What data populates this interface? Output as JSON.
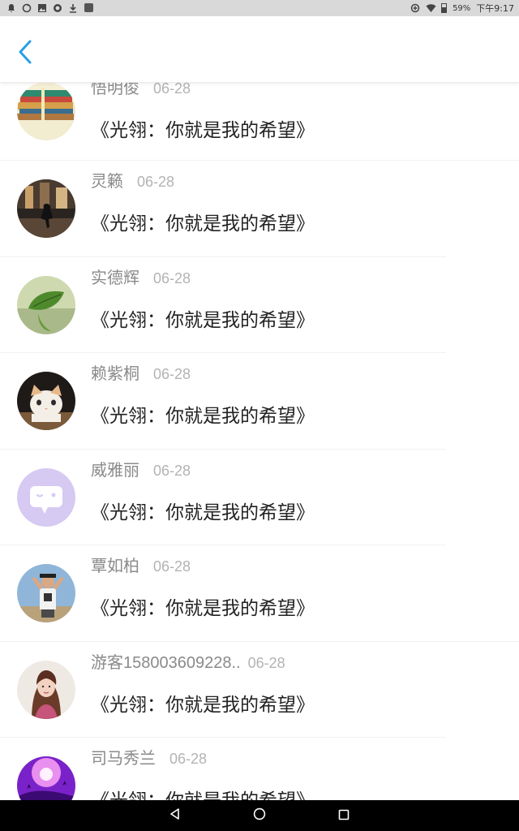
{
  "status_bar": {
    "battery": "59%",
    "time": "下午9:17",
    "left_icons": [
      "notification-icon",
      "sync-icon",
      "image-icon",
      "search-app-icon",
      "download-icon",
      "app-square-icon"
    ],
    "right_icons": [
      "data-saver-icon",
      "wifi-icon",
      "battery-icon"
    ]
  },
  "header": {
    "back_icon": "chevron-left-icon",
    "accent_color": "#2a9ee6"
  },
  "list": {
    "items": [
      {
        "name": "悟明俊",
        "date": "06-28",
        "title": "《光翎：你就是我的希望》",
        "avatar": "notebooks-photo"
      },
      {
        "name": "灵籁",
        "date": "06-28",
        "title": "《光翎：你就是我的希望》",
        "avatar": "night-city-figure-photo"
      },
      {
        "name": "实德辉",
        "date": "06-28",
        "title": "《光翎：你就是我的希望》",
        "avatar": "green-leaf-photo"
      },
      {
        "name": "赖紫桐",
        "date": "06-28",
        "title": "《光翎：你就是我的希望》",
        "avatar": "kitten-photo"
      },
      {
        "name": "威雅丽",
        "date": "06-28",
        "title": "《光翎：你就是我的希望》",
        "avatar": "chat-bubble-default-avatar"
      },
      {
        "name": "覃如柏",
        "date": "06-28",
        "title": "《光翎：你就是我的希望》",
        "avatar": "boy-sky-photo"
      },
      {
        "name": "游客158003609228..",
        "date": "06-28",
        "title": "《光翎：你就是我的希望》",
        "avatar": "girl-portrait-photo"
      },
      {
        "name": "司马秀兰",
        "date": "06-28",
        "title": "《光翎：你就是我的希望》",
        "avatar": "purple-fantasy-photo"
      }
    ]
  },
  "nav_bar": {
    "buttons": [
      "back-triangle-icon",
      "home-circle-icon",
      "recents-square-icon"
    ]
  }
}
